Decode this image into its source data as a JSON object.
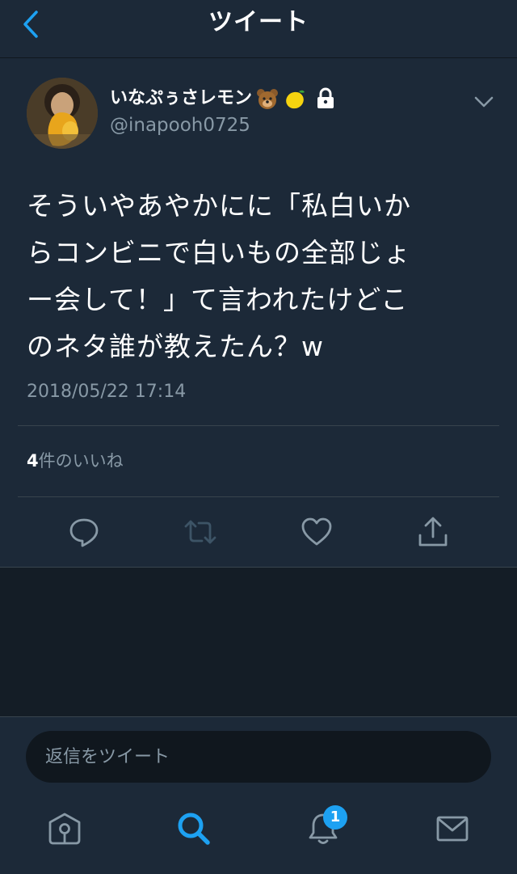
{
  "header": {
    "title": "ツイート"
  },
  "tweet": {
    "display_name": "いなぷぅさレモン",
    "handle": "@inapooh0725",
    "text": "そういやあやかにに「私白いか\nらコンビニで白いもの全部じょ\nー会して！」て言われたけどこ\nのネタ誰が教えたん？w",
    "timestamp": "2018/05/22 17:14",
    "likes_count": "4",
    "likes_label": "件のいいね"
  },
  "reply": {
    "placeholder": "返信をツイート"
  },
  "tabs": {
    "notification_badge": "1"
  },
  "colors": {
    "accent": "#1da1f2",
    "background": "#1c2938",
    "muted": "#8899a6"
  }
}
